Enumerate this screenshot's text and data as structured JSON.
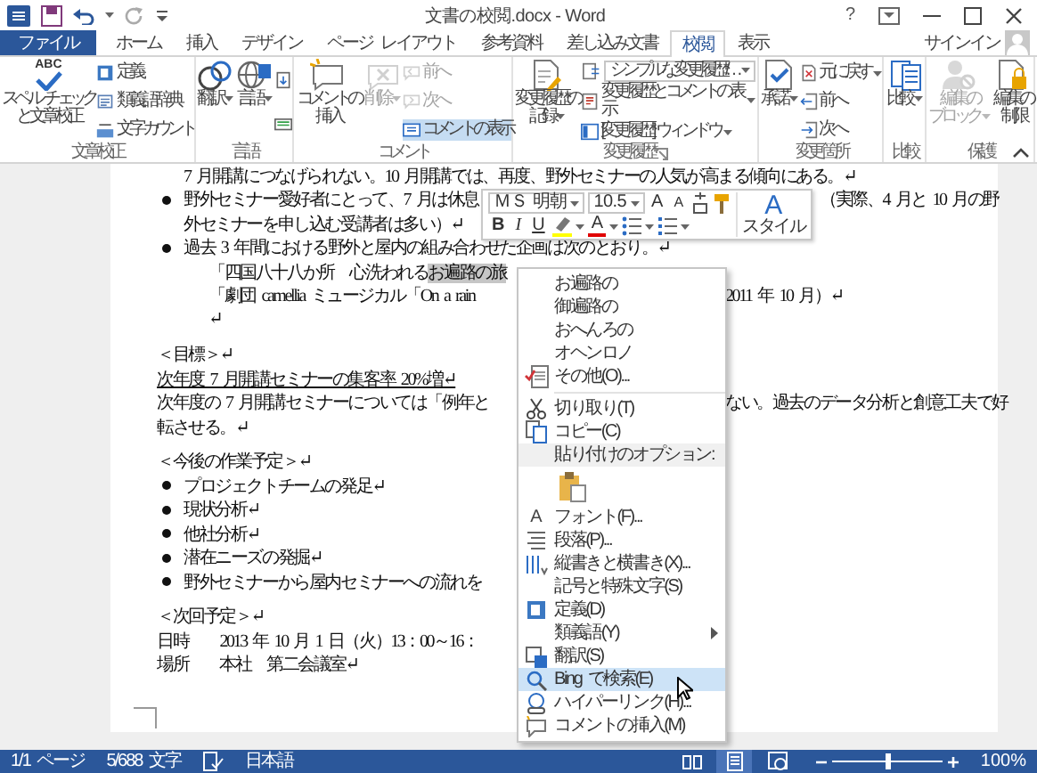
{
  "window": {
    "title": "文書の校閲.docx - Word",
    "help": "?",
    "account": "サインイン"
  },
  "tabs": [
    {
      "label": "ファイル",
      "kind": "file",
      "selected": false
    },
    {
      "label": "ホーム",
      "kind": "tab",
      "selected": false
    },
    {
      "label": "挿入",
      "kind": "tab",
      "selected": false
    },
    {
      "label": "デザイン",
      "kind": "tab",
      "selected": false
    },
    {
      "label": "ページ レイアウト",
      "kind": "tab",
      "selected": false
    },
    {
      "label": "参考資料",
      "kind": "tab",
      "selected": false
    },
    {
      "label": "差し込み文書",
      "kind": "tab",
      "selected": false
    },
    {
      "label": "校閲",
      "kind": "tab",
      "selected": true
    },
    {
      "label": "表示",
      "kind": "tab",
      "selected": false
    }
  ],
  "ribbon": {
    "groups": [
      {
        "label": "文章校正",
        "launcher": false,
        "columns": [
          {
            "kind": "large",
            "lines": [
              "スペル チェック",
              "と文章校正"
            ],
            "icon_text": "ABC",
            "menu": false,
            "disabled": false,
            "on": false
          },
          {
            "kind": "stack",
            "items": [
              {
                "kind": "button",
                "label": "定義",
                "menu": false,
                "disabled": false,
                "on": false
              },
              {
                "kind": "button",
                "label": "類義語辞典",
                "menu": false,
                "disabled": false,
                "on": false
              },
              {
                "kind": "button",
                "label": "文字カウント",
                "menu": false,
                "disabled": false,
                "on": false
              }
            ]
          }
        ]
      },
      {
        "label": "言語",
        "launcher": false,
        "columns": [
          {
            "kind": "large",
            "lines": [
              "翻訳"
            ],
            "menu": true,
            "disabled": false,
            "on": false
          },
          {
            "kind": "large",
            "lines": [
              "言語"
            ],
            "menu": true,
            "disabled": false,
            "on": false
          },
          {
            "kind": "stack",
            "items": [
              {
                "kind": "icon",
                "menu": false,
                "disabled": false,
                "on": false
              },
              {
                "kind": "icon",
                "menu": false,
                "disabled": false,
                "on": false
              }
            ]
          }
        ]
      },
      {
        "label": "コメント",
        "launcher": false,
        "columns": [
          {
            "kind": "large",
            "lines": [
              "コメントの",
              "挿入"
            ],
            "menu": false,
            "disabled": false,
            "on": false
          },
          {
            "kind": "large",
            "lines": [
              "削除"
            ],
            "menu": true,
            "disabled": true,
            "on": false
          },
          {
            "kind": "stack",
            "items": [
              {
                "kind": "button",
                "label": "前へ",
                "menu": false,
                "disabled": true,
                "on": false
              },
              {
                "kind": "button",
                "label": "次へ",
                "menu": false,
                "disabled": true,
                "on": false
              },
              {
                "kind": "button",
                "label": "コメントの表示",
                "menu": false,
                "disabled": false,
                "on": true
              }
            ]
          }
        ]
      },
      {
        "label": "変更履歴",
        "launcher": true,
        "columns": [
          {
            "kind": "large",
            "lines": [
              "変更履歴の",
              "記録"
            ],
            "menu": true,
            "disabled": false,
            "on": false
          },
          {
            "kind": "stack",
            "items": [
              {
                "kind": "combo",
                "value": "シンプルな変更履歴/…",
                "menu": true,
                "disabled": false,
                "on": false
              },
              {
                "kind": "button",
                "label": "変更履歴とコメントの表示",
                "menu": true,
                "disabled": false,
                "on": false
              },
              {
                "kind": "button",
                "label": "[変更履歴] ウィンドウ",
                "menu": true,
                "disabled": false,
                "on": false
              }
            ]
          }
        ]
      },
      {
        "label": "変更箇所",
        "launcher": false,
        "columns": [
          {
            "kind": "large",
            "lines": [
              "承諾"
            ],
            "menu": true,
            "disabled": false,
            "on": false
          },
          {
            "kind": "stack",
            "items": [
              {
                "kind": "button",
                "label": "元に戻す",
                "menu": true,
                "disabled": false,
                "on": false
              },
              {
                "kind": "button",
                "label": "前へ",
                "menu": false,
                "disabled": false,
                "on": false
              },
              {
                "kind": "button",
                "label": "次へ",
                "menu": false,
                "disabled": false,
                "on": false
              }
            ]
          }
        ]
      },
      {
        "label": "比較",
        "launcher": false,
        "columns": [
          {
            "kind": "large",
            "lines": [
              "比較"
            ],
            "menu": true,
            "disabled": false,
            "on": false
          }
        ]
      },
      {
        "label": "保護",
        "launcher": false,
        "columns": [
          {
            "kind": "large",
            "lines": [
              "編集の",
              "ブロック"
            ],
            "menu": true,
            "disabled": true,
            "on": false
          },
          {
            "kind": "large",
            "lines": [
              "編集の",
              "制限"
            ],
            "menu": false,
            "disabled": false,
            "on": false
          }
        ]
      }
    ]
  },
  "document": {
    "lines": [
      {
        "kind": "cont",
        "text": "7 月開講につなげられない。10 月開講では、再度、野外セミナーの人気が高まる傾向にある。↵",
        "underline": false
      },
      {
        "kind": "bullet",
        "text": "野外セミナー愛好者にとって、7 月は休息",
        "after": "（実際、4 月と 10 月の野",
        "under_toolbar": true,
        "underline": false
      },
      {
        "kind": "cont",
        "text": "外セミナーを申し込む受講者は多い）↵",
        "underline": false
      },
      {
        "kind": "bullet",
        "text": "過去 3 年間における野外と屋内の組み合わせた企画は次のとおり。↵",
        "underline": false
      },
      {
        "kind": "sub",
        "text": "「四国八十八か所　心洗われる",
        "selection": "お遍路の旅",
        "underline": false
      },
      {
        "kind": "sub",
        "text": "「劇団 camellia ミュージカル「On a rain",
        "after": "2011 年 10 月）↵",
        "under_toolbar": false,
        "underline": false
      },
      {
        "kind": "sub",
        "text": "↵",
        "underline": false
      },
      {
        "kind": "heading",
        "text": "＜目標＞↵",
        "underline": false
      },
      {
        "kind": "plain",
        "text": "次年度 7 月開講セミナーの集客率 20%増↵",
        "underline": true
      },
      {
        "kind": "plain",
        "text": "次年度の 7 月開講セミナーについては「例年と",
        "after": "ない。過去のデータ分析と創意工夫で好",
        "under_toolbar": false,
        "underline": false
      },
      {
        "kind": "plain",
        "text": "転させる。↵",
        "underline": false
      },
      {
        "kind": "heading",
        "text": "＜今後の作業予定＞↵",
        "underline": false
      },
      {
        "kind": "bullet",
        "text": "プロジェクトチームの発足↵",
        "underline": false
      },
      {
        "kind": "bullet",
        "text": "現状分析↵",
        "underline": false
      },
      {
        "kind": "bullet",
        "text": "他社分析↵",
        "underline": false
      },
      {
        "kind": "bullet",
        "text": "潜在ニーズの発掘↵",
        "underline": false
      },
      {
        "kind": "bullet",
        "text": "野外セミナーから屋内セミナーへの流れを",
        "underline": false
      },
      {
        "kind": "heading",
        "text": "＜次回予定＞↵",
        "underline": false
      },
      {
        "kind": "plain",
        "text": "日時　　2013 年 10 月 1 日（火）13：00～16：",
        "underline": false
      },
      {
        "kind": "plain",
        "text": "場所　　本社　第二会議室↵",
        "underline": false
      }
    ]
  },
  "mini_toolbar": {
    "font": "ＭＳ 明朝",
    "size": "10.5",
    "row1": [
      {
        "kind": "grow",
        "label": "A"
      },
      {
        "kind": "shrink",
        "label": "A"
      },
      {
        "kind": "phonetic"
      },
      {
        "kind": "painter"
      }
    ],
    "row2": [
      {
        "kind": "bold",
        "label": "B"
      },
      {
        "kind": "italic",
        "label": "I"
      },
      {
        "kind": "underline",
        "label": "U"
      },
      {
        "kind": "highlight"
      },
      {
        "kind": "font-color",
        "label": "A"
      },
      {
        "kind": "bullets"
      },
      {
        "kind": "numbering"
      }
    ],
    "styles": {
      "glyph": "A",
      "label": "スタイル"
    }
  },
  "context_menu": {
    "items": [
      {
        "kind": "suggestion",
        "label": "お遍路の",
        "selected": false,
        "submenu": false
      },
      {
        "kind": "suggestion",
        "label": "御遍路の",
        "selected": false,
        "submenu": false
      },
      {
        "kind": "suggestion",
        "label": "おへんろの",
        "selected": false,
        "submenu": false
      },
      {
        "kind": "suggestion",
        "label": "オヘンロノ",
        "selected": false,
        "submenu": false
      },
      {
        "kind": "command",
        "label": "その他(O)...",
        "selected": false,
        "submenu": false
      },
      {
        "kind": "separator"
      },
      {
        "kind": "command",
        "label": "切り取り(T)",
        "selected": false,
        "submenu": false
      },
      {
        "kind": "command",
        "label": "コピー(C)",
        "selected": false,
        "submenu": false
      },
      {
        "kind": "header",
        "label": "貼り付けのオプション:"
      },
      {
        "kind": "paste",
        "selected": false
      },
      {
        "kind": "command",
        "label": "フォント(F)...",
        "glyph": "A",
        "selected": false,
        "submenu": false
      },
      {
        "kind": "command",
        "label": "段落(P)...",
        "selected": false,
        "submenu": false
      },
      {
        "kind": "command",
        "label": "縦書きと横書き(X)...",
        "selected": false,
        "submenu": false
      },
      {
        "kind": "command",
        "label": "記号と特殊文字(S)",
        "selected": false,
        "submenu": false
      },
      {
        "kind": "command",
        "label": "定義(D)",
        "selected": false,
        "submenu": false
      },
      {
        "kind": "command",
        "label": "類義語(Y)",
        "selected": false,
        "submenu": true
      },
      {
        "kind": "command",
        "label": "翻訳(S)",
        "selected": false,
        "submenu": false
      },
      {
        "kind": "command",
        "label": "Bing で検索(E)",
        "selected": true,
        "submenu": false
      },
      {
        "kind": "command",
        "label": "ハイパーリンク(H)...",
        "selected": false,
        "submenu": false
      },
      {
        "kind": "command",
        "label": "コメントの挿入(M)",
        "selected": false,
        "submenu": false
      }
    ]
  },
  "status_bar": {
    "page": "1/1 ページ",
    "words": "5/688 文字",
    "language": "日本語",
    "views": [
      {
        "selected": false
      },
      {
        "selected": true
      },
      {
        "selected": false
      }
    ],
    "zoom_slider": {
      "level": 0.5
    },
    "zoom": "100%"
  }
}
